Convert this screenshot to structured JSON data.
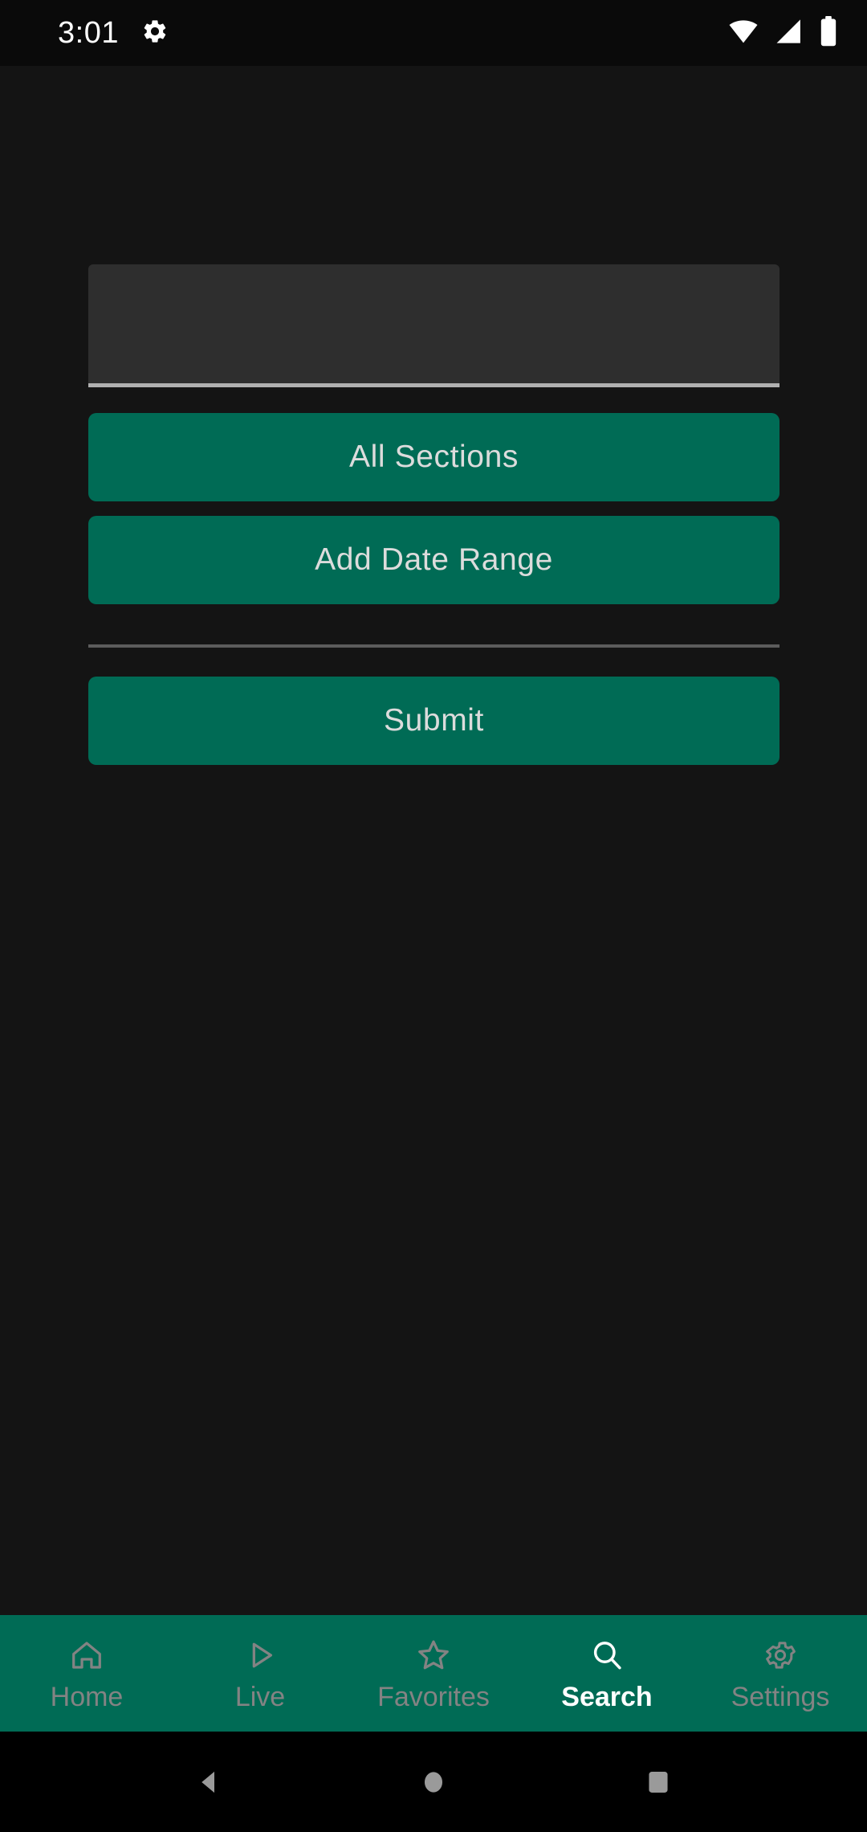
{
  "status_bar": {
    "clock": "3:01",
    "icons": {
      "notification": "settings-gear-icon",
      "wifi": "wifi-icon",
      "cellular": "cellular-signal-icon",
      "battery": "battery-full-icon"
    }
  },
  "search_form": {
    "query_value": "",
    "query_placeholder": "",
    "sections_button_label": "All Sections",
    "date_range_button_label": "Add Date Range",
    "submit_button_label": "Submit"
  },
  "tab_bar": {
    "active_tab": "Search",
    "tabs": [
      {
        "label": "Home",
        "icon": "home-icon",
        "active": false
      },
      {
        "label": "Live",
        "icon": "play-icon",
        "active": false
      },
      {
        "label": "Favorites",
        "icon": "star-icon",
        "active": false
      },
      {
        "label": "Search",
        "icon": "search-icon",
        "active": true
      },
      {
        "label": "Settings",
        "icon": "gear-icon",
        "active": false
      }
    ]
  },
  "system_nav": {
    "back": "back-triangle-icon",
    "home": "home-circle-icon",
    "recents": "recents-square-icon"
  },
  "colors": {
    "background": "#141414",
    "status_bar": "#0a0a0a",
    "accent_teal": "#006b55",
    "field_fill": "#2e2e2e",
    "field_underline": "#b0b0b0",
    "divider": "#5c5c5c",
    "button_text": "#dcdcdc",
    "tab_inactive": "#838383",
    "tab_active": "#ffffff",
    "nav_icon": "#9a9a9a"
  }
}
